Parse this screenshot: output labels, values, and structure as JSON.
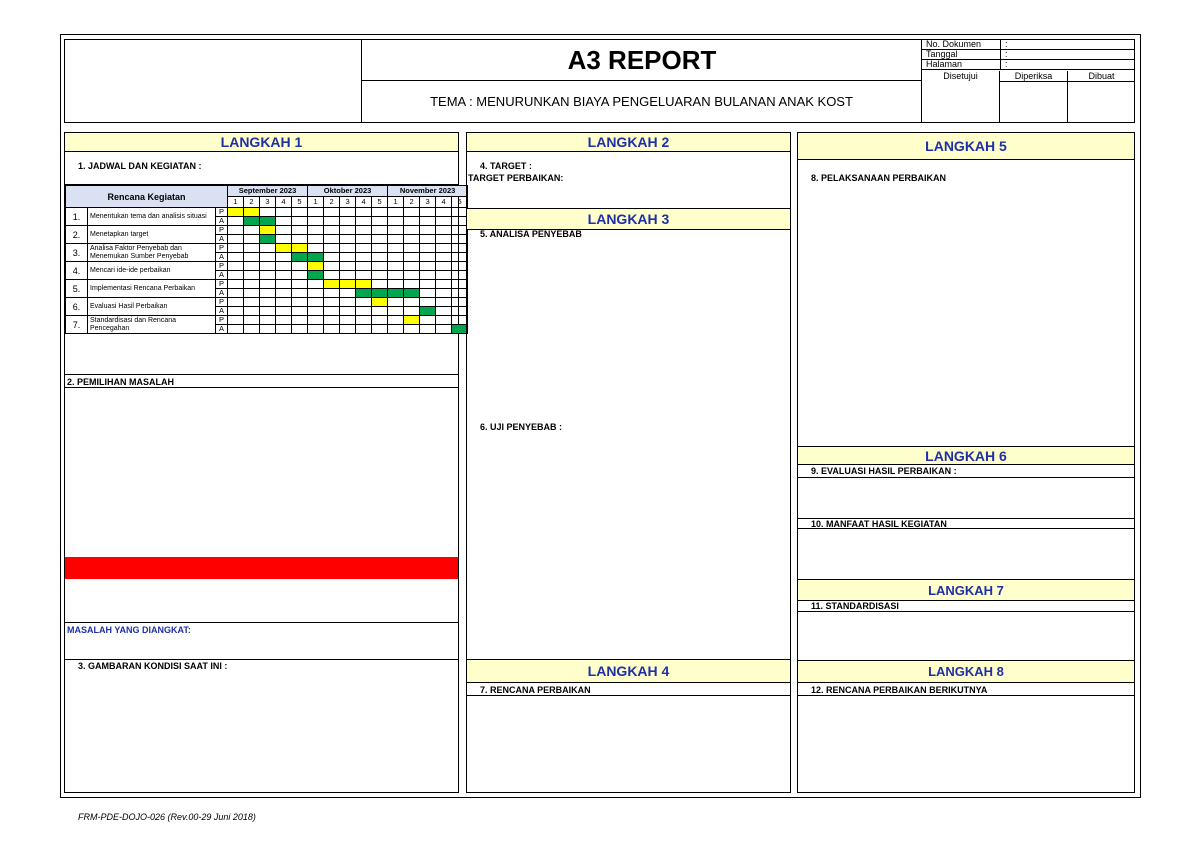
{
  "header": {
    "title": "A3 REPORT",
    "tema": "TEMA : MENURUNKAN BIAYA PENGELUARAN BULANAN ANAK KOST",
    "meta": [
      {
        "label": "No. Dokumen",
        "value": ":"
      },
      {
        "label": "Tanggal",
        "value": ":"
      },
      {
        "label": "Halaman",
        "value": ":"
      }
    ],
    "approvals": [
      "Disetujui",
      "Diperiksa",
      "Dibuat"
    ]
  },
  "langkah1": {
    "title": "LANGKAH 1",
    "jadwal_label": "1. JADWAL DAN KEGIATAN :",
    "gantt": {
      "activity_header": "Rencana Kegiatan",
      "months": [
        "September 2023",
        "Oktober 2023",
        "November 2023"
      ],
      "weeks": [
        "1",
        "2",
        "3",
        "4",
        "5",
        "1",
        "2",
        "3",
        "4",
        "5",
        "1",
        "2",
        "3",
        "4",
        "5"
      ],
      "tasks": [
        {
          "no": "1.",
          "name": "Menentukan tema dan analisis situasi",
          "P": [
            1,
            2
          ],
          "A": [
            2,
            3
          ]
        },
        {
          "no": "2.",
          "name": "Menetapkan target",
          "P": [
            3
          ],
          "A": [
            3
          ]
        },
        {
          "no": "3.",
          "name": "Analisa Faktor Penyebab dan Menemukan Sumber Penyebab",
          "P": [
            4,
            5
          ],
          "A": [
            5,
            6
          ]
        },
        {
          "no": "4.",
          "name": "Mencari ide-ide perbaikan",
          "P": [
            6
          ],
          "A": [
            6
          ]
        },
        {
          "no": "5.",
          "name": "Implementasi Rencana Perbaikan",
          "P": [
            7,
            8,
            9
          ],
          "A": [
            9,
            10,
            11,
            12
          ]
        },
        {
          "no": "6.",
          "name": "Evaluasi Hasil Perbaikan",
          "P": [
            10
          ],
          "A": [
            13
          ]
        },
        {
          "no": "7.",
          "name": "Standardisasi dan Rencana Pencegahan",
          "P": [
            12
          ],
          "A": [
            15
          ]
        }
      ],
      "plan_label": "P",
      "actual_label": "A"
    },
    "pemilihan_label": "2. PEMILIHAN MASALAH",
    "masalah_label": "MASALAH YANG DIANGKAT:",
    "gambaran_label": "3. GAMBARAN KONDISI SAAT INI :"
  },
  "langkah2": {
    "title": "LANGKAH 2",
    "target_label": "4. TARGET :",
    "target_perbaikan_label": "TARGET PERBAIKAN:"
  },
  "langkah3": {
    "title": "LANGKAH 3",
    "analisa_label": "5. ANALISA PENYEBAB",
    "uji_label": "6. UJI PENYEBAB :"
  },
  "langkah4": {
    "title": "LANGKAH 4",
    "rencana_label": "7. RENCANA PERBAIKAN"
  },
  "langkah5": {
    "title": "LANGKAH 5",
    "pelaksanaan_label": "8. PELAKSANAAN PERBAIKAN"
  },
  "langkah6": {
    "title": "LANGKAH 6",
    "evaluasi_label": "9. EVALUASI HASIL PERBAIKAN  :",
    "manfaat_label": "10. MANFAAT HASIL KEGIATAN"
  },
  "langkah7": {
    "title": "LANGKAH 7",
    "standar_label": "11. STANDARDISASI"
  },
  "langkah8": {
    "title": "LANGKAH 8",
    "rencana_label": "12. RENCANA PERBAIKAN BERIKUTNYA"
  },
  "footer": "FRM-PDE-DOJO-026 (Rev.00-29 Juni 2018)",
  "colors": {
    "plan": "#ffff00",
    "actual": "#00a550",
    "highlight": "#ff0000",
    "section_bg": "#ffffcc",
    "section_text": "#1f2fa8"
  }
}
